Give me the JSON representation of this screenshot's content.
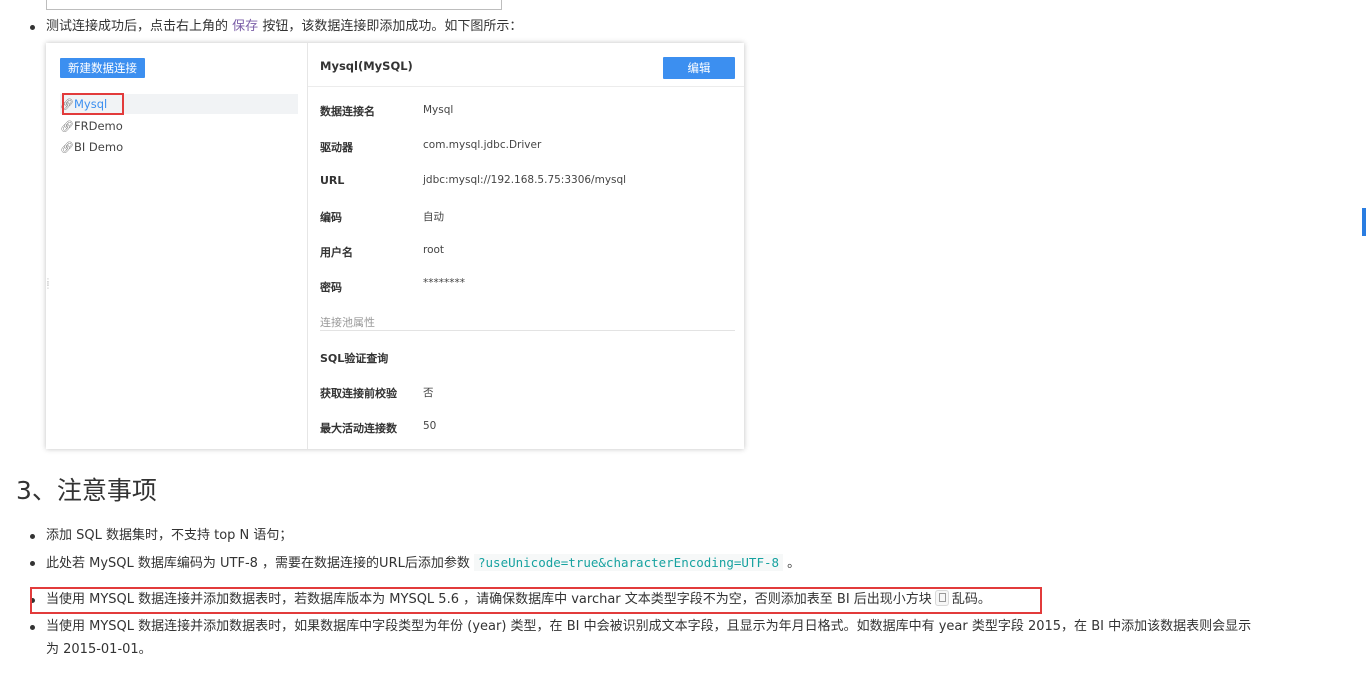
{
  "intro_text": {
    "before": "测试连接成功后，点击右上角的",
    "link": "保存",
    "after": "按钮，该数据连接即添加成功。如下图所示："
  },
  "screenshot": {
    "new_button": "新建数据连接",
    "connections": [
      {
        "label": "Mysql",
        "icon": "link-icon"
      },
      {
        "label": "FRDemo",
        "icon": "link-icon"
      },
      {
        "label": "BI Demo",
        "icon": "link-icon"
      }
    ],
    "detail_title": "Mysql(MySQL)",
    "edit_button": "编辑",
    "fields": [
      {
        "label": "数据连接名",
        "value": "Mysql"
      },
      {
        "label": "驱动器",
        "value": "com.mysql.jdbc.Driver"
      },
      {
        "label": "URL",
        "value": "jdbc:mysql://192.168.5.75:3306/mysql"
      },
      {
        "label": "编码",
        "value": "自动"
      },
      {
        "label": "用户名",
        "value": "root"
      },
      {
        "label": "密码",
        "value": "********"
      }
    ],
    "pool_title": "连接池属性",
    "pool_fields": [
      {
        "label": "SQL验证查询",
        "value": ""
      },
      {
        "label": "获取连接前校验",
        "value": "否"
      },
      {
        "label": "最大活动连接数",
        "value": "50"
      }
    ]
  },
  "section_heading": "3、注意事项",
  "notes": {
    "note1": "添加 SQL 数据集时，不支持 top N 语句；",
    "note2_before": "此处若 MySQL 数据库编码为 UTF-8 ，需要在数据连接的URL后添加参数",
    "note2_code": "?useUnicode=true&characterEncoding=UTF-8",
    "note2_after": "。",
    "note3_before": "当使用 MYSQL 数据连接并添加数据表时，若数据库版本为 MYSQL 5.6 ，请确保数据库中 varchar 文本类型字段不为空，否则添加表至 BI 后出现小方块",
    "note3_after": "乱码。",
    "note4_line1": "当使用 MYSQL 数据连接并添加数据表时，如果数据库中字段类型为年份 (year) 类型，在 BI 中会被识别成文本字段，且显示为年月日格式。如数据库中有 year 类型字段 2015，在 BI 中添加该数据表则会显示",
    "note4_line2": "为 2015-01-01。"
  },
  "colors": {
    "accent": "#3c8ff0",
    "highlight_frame": "#e23b3b",
    "code": "#17a2a0",
    "link": "#7b5ea7"
  }
}
